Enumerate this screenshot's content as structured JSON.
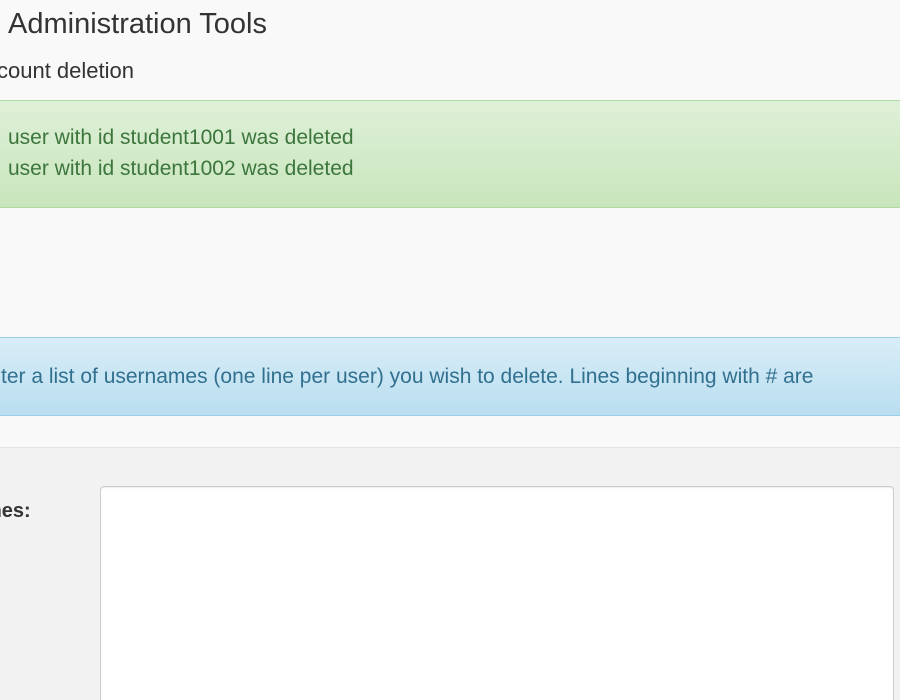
{
  "header": {
    "title": "Administration Tools",
    "subtitle": "ccount deletion"
  },
  "alerts": {
    "success": {
      "messages": [
        "user with id student1001 was deleted",
        "user with id student1002 was deleted"
      ],
      "color": "#3c763d"
    },
    "info": {
      "message": "ter a list of usernames (one line per user) you wish to delete. Lines beginning with # are",
      "color": "#31708f"
    }
  },
  "form": {
    "usernames_label": "mes:",
    "usernames_value": ""
  }
}
